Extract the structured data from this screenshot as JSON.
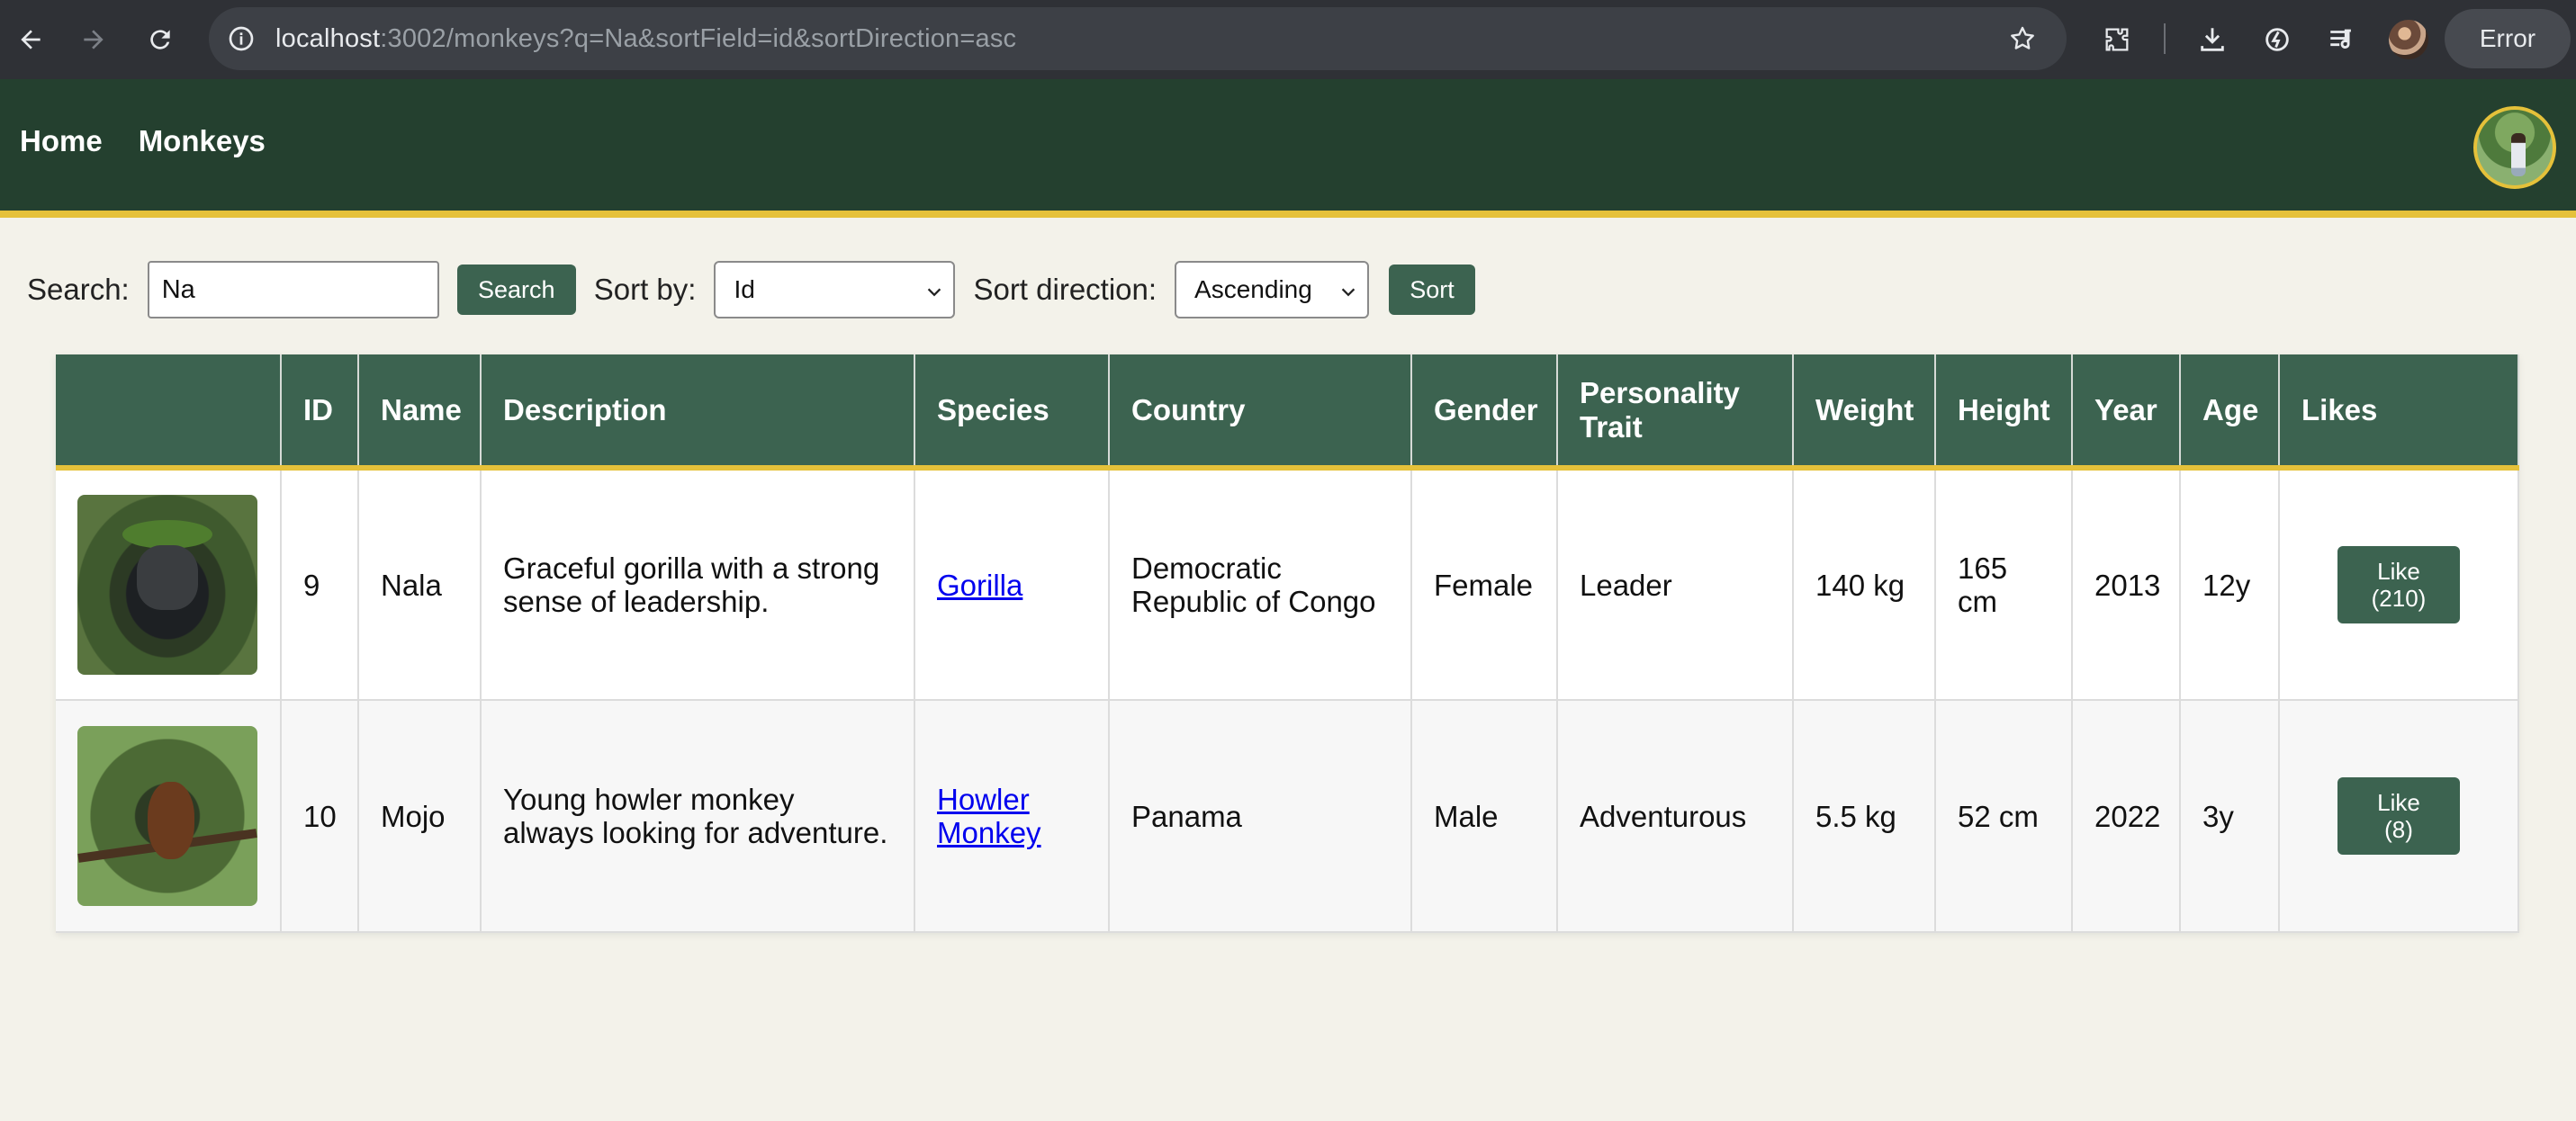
{
  "browser": {
    "url_host": "localhost",
    "url_rest": ":3002/monkeys?q=Na&sortField=id&sortDirection=asc",
    "error_label": "Error"
  },
  "nav": {
    "home": "Home",
    "monkeys": "Monkeys"
  },
  "controls": {
    "search_label": "Search:",
    "search_value": "Na",
    "search_button": "Search",
    "sort_by_label": "Sort by:",
    "sort_by_value": "Id",
    "sort_direction_label": "Sort direction:",
    "sort_direction_value": "Ascending",
    "sort_button": "Sort"
  },
  "table": {
    "headers": [
      "",
      "ID",
      "Name",
      "Description",
      "Species",
      "Country",
      "Gender",
      "Personality Trait",
      "Weight",
      "Height",
      "Year",
      "Age",
      "Likes"
    ],
    "rows": [
      {
        "id": "9",
        "name": "Nala",
        "description": "Graceful gorilla with a strong sense of leadership.",
        "species": "Gorilla",
        "country": "Democratic Republic of Congo",
        "gender": "Female",
        "trait": "Leader",
        "weight": "140 kg",
        "height": "165 cm",
        "year": "2013",
        "age": "12y",
        "like_label": "Like",
        "like_count": "(210)"
      },
      {
        "id": "10",
        "name": "Mojo",
        "description": "Young howler monkey always looking for adventure.",
        "species": "Howler Monkey",
        "country": "Panama",
        "gender": "Male",
        "trait": "Adventurous",
        "weight": "5.5 kg",
        "height": "52 cm",
        "year": "2022",
        "age": "3y",
        "like_label": "Like",
        "like_count": "(8)"
      }
    ]
  },
  "colors": {
    "header_bg": "#24402f",
    "accent_gold": "#e5c13a",
    "button_green": "#3c6350",
    "page_bg": "#f3f2ea"
  }
}
